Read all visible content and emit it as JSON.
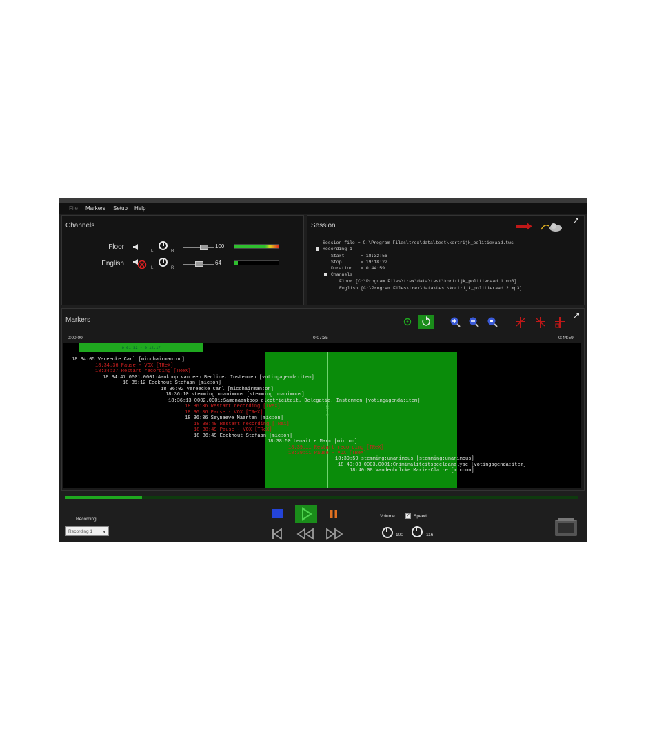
{
  "menu": {
    "file": "File",
    "markers": "Markers",
    "setup": "Setup",
    "help": "Help"
  },
  "channels": {
    "title": "Channels",
    "items": [
      {
        "name": "Floor",
        "l": "L",
        "r": "R",
        "volume": "100",
        "muted": false,
        "level": 1.0
      },
      {
        "name": "English",
        "l": "L",
        "r": "R",
        "volume": "64",
        "muted": true,
        "level": 0.08
      }
    ]
  },
  "session": {
    "title": "Session",
    "lines": [
      "Session file = C:\\Program Files\\trex\\data\\test\\kortrijk_politieraad.tws",
      "Recording 1",
      "Start      = 18:32:56",
      "Stop       = 19:18:22",
      "Duration   = 0:44:59",
      "Channels",
      "Floor [C:\\Program Files\\trex\\data\\test\\kortrijk_politieraad.1.mp3]",
      "English [C:\\Program Files\\trex\\data\\test\\kortrijk_politieraad.2.mp3]"
    ]
  },
  "markers": {
    "title": "Markers",
    "time_start": "0:00:00",
    "time_mid": "0:07:35",
    "time_end": "0:44:59",
    "range_label": "0:01:52 - 0:12:17",
    "cursor_label": "0:16:40",
    "selection_fraction": [
      0.39,
      0.76
    ],
    "range_fraction": [
      0.03,
      0.27
    ],
    "entries": [
      {
        "text": "18:34:05 Vereecke Carl [micchairman:on]",
        "color": "#e0e0e0"
      },
      {
        "text": "18:34:36 Pause - VOX [TReX]",
        "color": "#d42020"
      },
      {
        "text": "18:34:37 Restart recording [TReX]",
        "color": "#d42020"
      },
      {
        "text": "18:34:47 0001.0001:Aankoop van een Berline. Instemmen [votingagenda:item]",
        "color": "#e0e0e0"
      },
      {
        "text": "18:35:12 Eeckhout Stefaan [mic:on]",
        "color": "#e0e0e0"
      },
      {
        "text": "18:36:02 Vereecke Carl [micchairman:on]",
        "color": "#e0e0e0"
      },
      {
        "text": "18:36:10 stemming:unanimous [stemming:unanimous]",
        "color": "#e0e0e0"
      },
      {
        "text": "18:36:13 0002.0001:Samenaankoop electriciteit. Delegatie. Instemmen [votingagenda:item]",
        "color": "#e0e0e0"
      },
      {
        "text": "18:36:36 Restart recording [TReX]",
        "color": "#d42020"
      },
      {
        "text": "18:36:36 Pause - VOX [TReX]",
        "color": "#d42020"
      },
      {
        "text": "18:36:36 Seynaeve Maarten [mic:on]",
        "color": "#e0e0e0"
      },
      {
        "text": "18:38:49 Restart recording [TReX]",
        "color": "#d42020"
      },
      {
        "text": "18:38:49 Pause - VOX [TReX]",
        "color": "#d42020"
      },
      {
        "text": "18:36:49 Eeckhout Stefaan [mic:on]",
        "color": "#e0e0e0"
      },
      {
        "text": "18:38:50 Lemaitre Marc [mic:on]",
        "color": "#e0e0e0"
      },
      {
        "text": "18:39:11 Restart recording [TReX]",
        "color": "#d42020"
      },
      {
        "text": "18:39:11 Pause - VOX [TReX]",
        "color": "#d42020"
      },
      {
        "text": "18:39:59 stemming:unanimous [stemming:unanimous]",
        "color": "#e0e0e0"
      },
      {
        "text": "18:40:03 0003.0001:Criminaliteitsbeeldanalyse [votingagenda:item]",
        "color": "#e0e0e0"
      },
      {
        "text": "18:40:08 Vandenbulcke Marie-Claire [mic:on]",
        "color": "#e0e0e0"
      }
    ]
  },
  "playback": {
    "progress": 0.15,
    "recording_label": "Recording",
    "recording_selected": "Recording 1",
    "volume_label": "Volume",
    "speed_label": "Speed",
    "speed_checked": true,
    "volume_value": "100",
    "speed_value": "116"
  },
  "colors": {
    "accent_green": "#1fa81f",
    "selection_green": "#0a8c0a",
    "marker_red": "#d42020",
    "pause_orange": "#e07020"
  }
}
